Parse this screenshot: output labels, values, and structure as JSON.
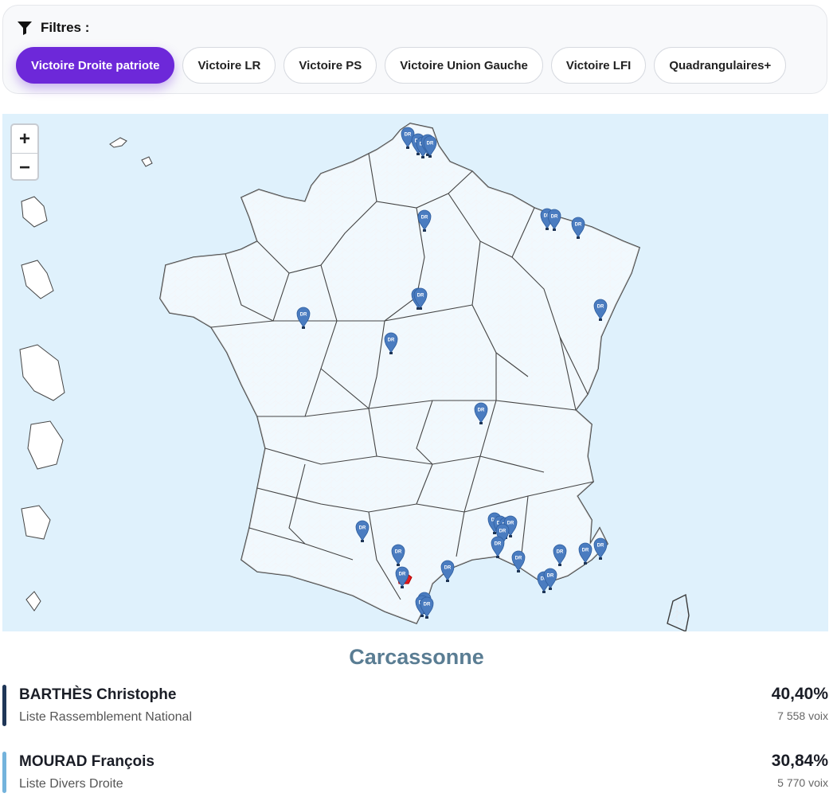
{
  "filters": {
    "title": "Filtres :",
    "chips": [
      {
        "label": "Victoire Droite patriote",
        "active": true
      },
      {
        "label": "Victoire LR",
        "active": false
      },
      {
        "label": "Victoire PS",
        "active": false
      },
      {
        "label": "Victoire Union Gauche",
        "active": false
      },
      {
        "label": "Victoire LFI",
        "active": false
      },
      {
        "label": "Quadrangulaires+",
        "active": false
      }
    ]
  },
  "map": {
    "zoom_in": "+",
    "zoom_out": "−",
    "marker_label": "DR",
    "colors": {
      "sea": "#dff1fc",
      "land": "#ffffff",
      "marker": "#4a7cc0",
      "selected": "#e31a1c"
    }
  },
  "result": {
    "city": "Carcassonne",
    "candidates": [
      {
        "name": "BARTHÈS Christophe",
        "list": "Liste Rassemblement National",
        "pct": "40,40%",
        "votes": "7 558 voix",
        "color": "#1f3657"
      },
      {
        "name": "MOURAD François",
        "list": "Liste Divers Droite",
        "pct": "30,84%",
        "votes": "5 770 voix",
        "color": "#74b3dc"
      }
    ]
  }
}
